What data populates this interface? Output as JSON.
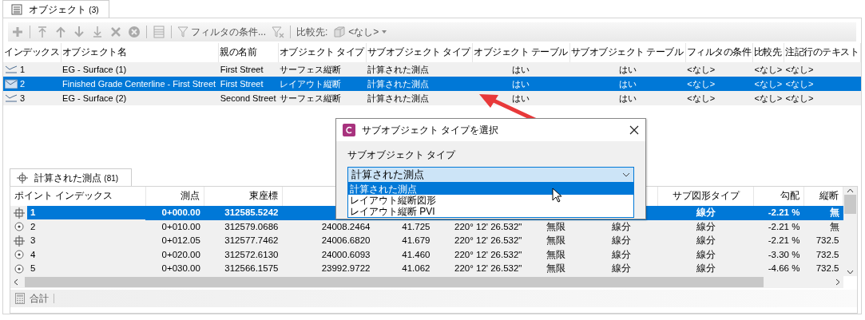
{
  "objects_tab": {
    "label": "オブジェクト",
    "count": "(3)",
    "selected": true
  },
  "toolbar": {
    "filter_label": "フィルタの条件...",
    "compare_label": "比較先:",
    "compare_value": "<なし>"
  },
  "objects_table": {
    "columns": [
      "インデックス",
      "オブジェクト名",
      "親の名前",
      "オブジェクト タイプ",
      "サブオブジェクト タイプ",
      "オブジェクト テーブル",
      "サブオブジェクト テーブル",
      "フィルタの条件",
      "比較先",
      "注記行のテキスト"
    ],
    "rows": [
      {
        "selected": false,
        "cells": [
          "1",
          "EG - Surface (1)",
          "First Street",
          "サーフェス縦断",
          "計算された測点",
          "はい",
          "はい",
          "<なし>",
          "<なし>",
          "<なし>"
        ]
      },
      {
        "selected": true,
        "cells": [
          "2",
          "Finished Grade Centerline - First Street",
          "First Street",
          "レイアウト縦断",
          "計算された測点",
          "はい",
          "はい",
          "<なし>",
          "<なし>",
          "<なし>"
        ]
      },
      {
        "selected": false,
        "cells": [
          "3",
          "EG - Surface (2)",
          "Second Street",
          "サーフェス縦断",
          "計算された測点",
          "はい",
          "はい",
          "<なし>",
          "<なし>",
          "<なし>"
        ]
      }
    ]
  },
  "points_tab": {
    "label": "計算された測点",
    "count": "(81)",
    "selected": true
  },
  "points_table": {
    "columns": [
      "ポイント インデックス",
      "測点",
      "東座標",
      null,
      null,
      null,
      null,
      null,
      "サブ図形タイプ",
      "勾配",
      "縦断"
    ],
    "rows": [
      {
        "kind": "crosshair",
        "selected": true,
        "cells": [
          "1",
          "0+000.00",
          "312585.5242",
          null,
          null,
          null,
          null,
          null,
          "線分",
          "-2.21 %",
          "無"
        ]
      },
      {
        "kind": "dot",
        "selected": false,
        "cells": [
          "2",
          "0+010.00",
          "312579.0686",
          "24008.2464",
          "41.725",
          "220° 12' 26.532\"",
          "無限",
          "線分",
          "線分",
          "-2.21 %",
          "無"
        ]
      },
      {
        "kind": "crosshair",
        "selected": false,
        "cells": [
          "3",
          "0+012.05",
          "312577.7462",
          "24006.6820",
          "41.679",
          "220° 12' 26.532\"",
          "無限",
          "線分",
          "線分",
          "-2.21 %",
          "732.5"
        ]
      },
      {
        "kind": "dot",
        "selected": false,
        "cells": [
          "4",
          "0+020.00",
          "312572.6130",
          "24000.6093",
          "41.460",
          "220° 12' 26.532\"",
          "無限",
          "線分",
          "線分",
          "-3.30 %",
          "732.5"
        ]
      },
      {
        "kind": "dot",
        "selected": false,
        "cells": [
          "5",
          "0+030.00",
          "312566.1575",
          "23992.9722",
          "41.062",
          "220° 12' 26.532\"",
          "無限",
          "線分",
          "線分",
          "-4.66 %",
          "732.5"
        ]
      }
    ]
  },
  "status_bar": {
    "label": "合計"
  },
  "dialog": {
    "title": "サブオブジェクト タイプを選択",
    "field_label": "サブオブジェクト タイプ",
    "value": "計算された測点",
    "options": [
      {
        "label": "計算された測点",
        "selected": true
      },
      {
        "label": "レイアウト縦断図形",
        "selected": false
      },
      {
        "label": "レイアウト縦断 PVI",
        "selected": false
      }
    ]
  }
}
